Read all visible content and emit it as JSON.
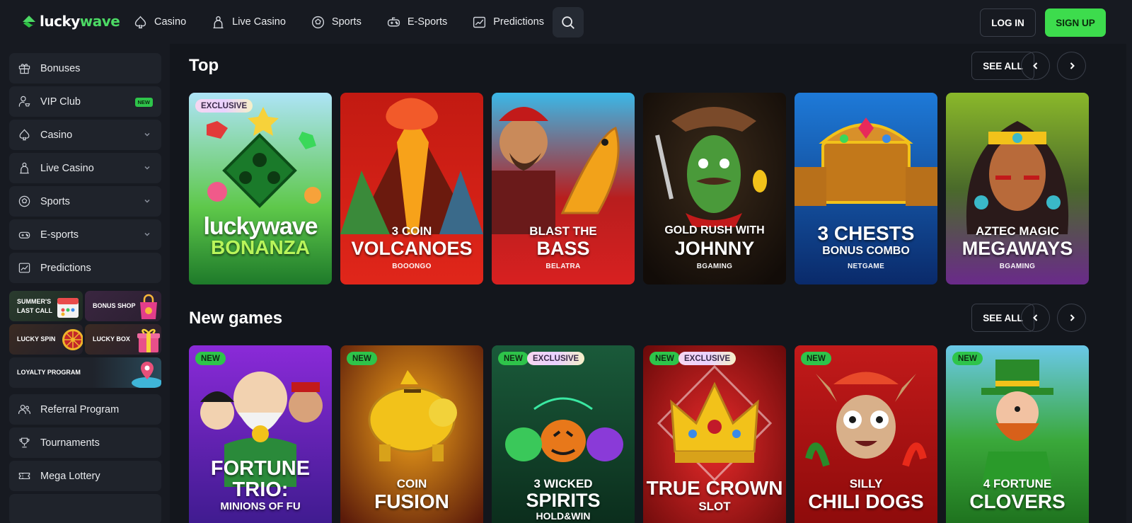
{
  "header": {
    "logo": {
      "part1": "lucky",
      "part2": "wave"
    },
    "nav": [
      {
        "label": "Casino",
        "icon": "spade-icon"
      },
      {
        "label": "Live Casino",
        "icon": "dealer-icon"
      },
      {
        "label": "Sports",
        "icon": "soccer-ball-icon"
      },
      {
        "label": "E-Sports",
        "icon": "gamepad-icon"
      },
      {
        "label": "Predictions",
        "icon": "chart-icon"
      }
    ],
    "login_label": "LOG IN",
    "signup_label": "SIGN UP"
  },
  "sidebar": {
    "items": [
      {
        "label": "Bonuses",
        "icon": "gift-icon"
      },
      {
        "label": "VIP Club",
        "icon": "vip-user-icon",
        "badge": "NEW"
      },
      {
        "label": "Casino",
        "icon": "spade-icon",
        "expandable": true
      },
      {
        "label": "Live Casino",
        "icon": "dealer-icon",
        "expandable": true
      },
      {
        "label": "Sports",
        "icon": "soccer-ball-icon",
        "expandable": true
      },
      {
        "label": "E-sports",
        "icon": "gamepad-icon",
        "expandable": true
      },
      {
        "label": "Predictions",
        "icon": "chart-icon"
      }
    ],
    "promos": [
      {
        "line1": "SUMMER'S",
        "line2": "LAST CALL"
      },
      {
        "line1": "BONUS SHOP",
        "line2": ""
      },
      {
        "line1": "LUCKY SPIN",
        "line2": ""
      },
      {
        "line1": "LUCKY BOX",
        "line2": ""
      },
      {
        "line1": "LOYALTY PROGRAM",
        "line2": ""
      }
    ],
    "bottom_items": [
      {
        "label": "Referral Program",
        "icon": "users-icon"
      },
      {
        "label": "Tournaments",
        "icon": "trophy-icon"
      },
      {
        "label": "Mega Lottery",
        "icon": "ticket-icon"
      }
    ]
  },
  "sections": [
    {
      "title": "Top",
      "see_all": "SEE ALL",
      "games": [
        {
          "badges": [
            "EXCLUSIVE"
          ],
          "title1": "luckywave",
          "title2": "BONANZA",
          "provider": ""
        },
        {
          "badges": [],
          "title1": "3 COIN",
          "title2": "VOLCANOES",
          "provider": "BOOONGO"
        },
        {
          "badges": [],
          "title1": "BLAST THE",
          "title2": "BASS",
          "provider": "BELATRA"
        },
        {
          "badges": [],
          "title1": "GOLD RUSH WITH",
          "title2": "JOHNNY",
          "provider": "BGAMING"
        },
        {
          "badges": [],
          "title1": "3 CHESTS",
          "title2": "BONUS COMBO",
          "provider": "NETGAME"
        },
        {
          "badges": [],
          "title1": "AZTEC MAGIC",
          "title2": "MEGAWAYS",
          "provider": "BGAMING"
        }
      ]
    },
    {
      "title": "New games",
      "see_all": "SEE ALL",
      "games": [
        {
          "badges": [
            "NEW"
          ],
          "title1": "FORTUNE",
          "title2": "TRIO:",
          "title3": "MINIONS OF FU"
        },
        {
          "badges": [
            "NEW"
          ],
          "title1": "COIN",
          "title2": "FUSION",
          "title3": ""
        },
        {
          "badges": [
            "NEW",
            "EXCLUSIVE"
          ],
          "title1": "3 WICKED",
          "title2": "SPIRITS",
          "title3": "HOLD&WIN"
        },
        {
          "badges": [
            "NEW",
            "EXCLUSIVE"
          ],
          "title1": "TRUE CROWN",
          "title2": "SLOT",
          "title3": ""
        },
        {
          "badges": [
            "NEW"
          ],
          "title1": "SILLY",
          "title2": "CHILI DOGS",
          "title3": ""
        },
        {
          "badges": [
            "NEW"
          ],
          "title1": "4 FORTUNE",
          "title2": "CLOVERS",
          "title3": ""
        }
      ]
    }
  ],
  "colors": {
    "background": "#13161c",
    "panel": "#171a21",
    "sidebar_item": "#1f232b",
    "accent_green": "#3ddc4d"
  }
}
